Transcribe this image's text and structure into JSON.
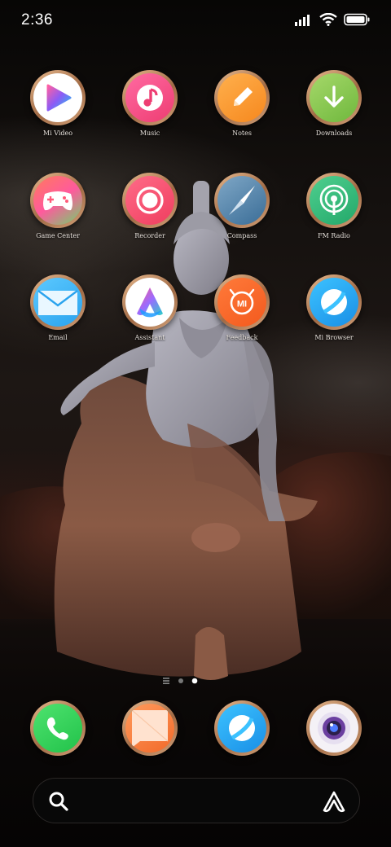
{
  "status": {
    "time": "2:36"
  },
  "apps": [
    {
      "id": "mi-video",
      "label": "Mi Video",
      "icon": "play-icon"
    },
    {
      "id": "music",
      "label": "Music",
      "icon": "music-note-icon"
    },
    {
      "id": "notes",
      "label": "Notes",
      "icon": "pencil-icon"
    },
    {
      "id": "downloads",
      "label": "Downloads",
      "icon": "download-arrow-icon"
    },
    {
      "id": "game-center",
      "label": "Game Center",
      "icon": "gamepad-icon"
    },
    {
      "id": "recorder",
      "label": "Recorder",
      "icon": "record-icon"
    },
    {
      "id": "compass",
      "label": "Compass",
      "icon": "compass-needle-icon"
    },
    {
      "id": "fm-radio",
      "label": "FM Radio",
      "icon": "radio-waves-icon"
    },
    {
      "id": "email",
      "label": "Email",
      "icon": "envelope-icon"
    },
    {
      "id": "assistant",
      "label": "Assistant",
      "icon": "assistant-logo-icon"
    },
    {
      "id": "feedback",
      "label": "Feedback",
      "icon": "mi-logo-icon"
    },
    {
      "id": "mi-browser",
      "label": "Mi Browser",
      "icon": "browser-globe-icon"
    }
  ],
  "feedback_logo_text": "MI",
  "dock": [
    {
      "id": "phone",
      "icon": "phone-handset-icon"
    },
    {
      "id": "messaging",
      "icon": "message-icon"
    },
    {
      "id": "browser",
      "icon": "browser-globe-icon"
    },
    {
      "id": "camera",
      "icon": "camera-lens-icon"
    }
  ],
  "page_indicator": {
    "pages": 2,
    "current_page": 2
  },
  "search": {
    "left_icon": "search-icon",
    "right_icon": "assistant-icon"
  }
}
